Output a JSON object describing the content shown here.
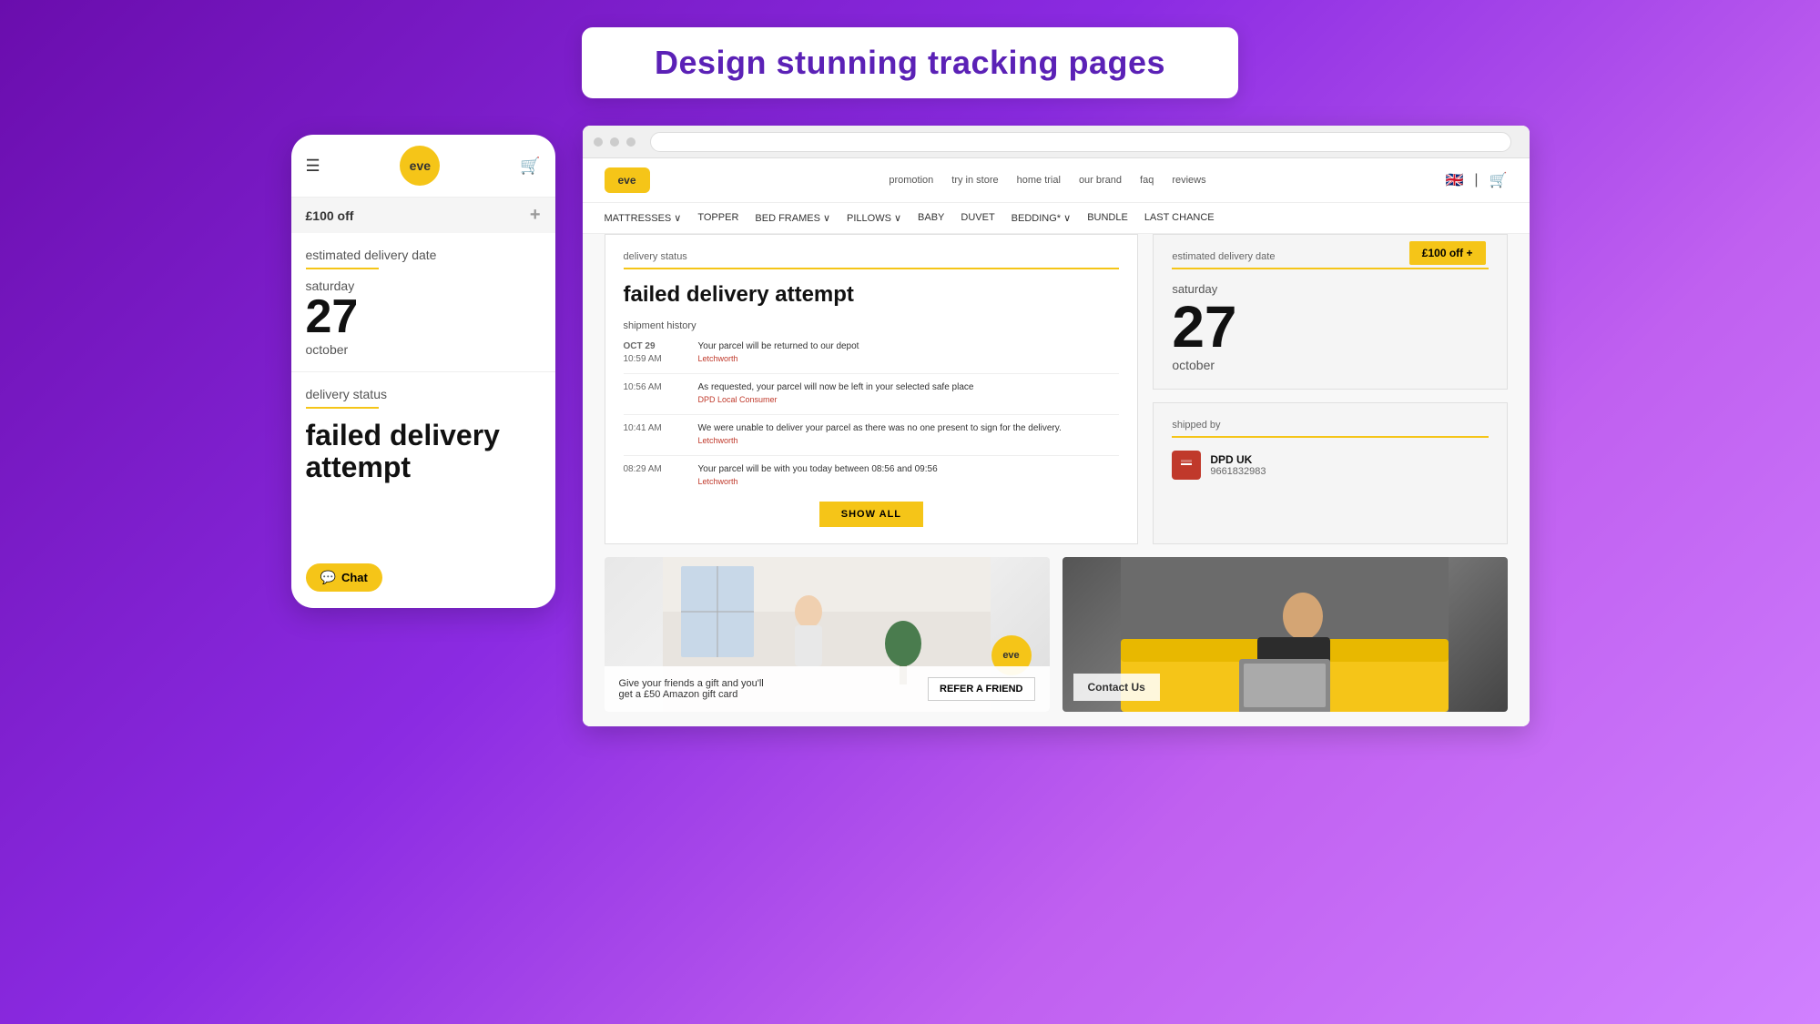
{
  "header": {
    "title": "Design stunning tracking pages"
  },
  "mobile": {
    "logo": "eve",
    "promo": "£100 off",
    "estimated_delivery": {
      "label": "estimated delivery date",
      "day_name": "saturday",
      "day_number": "27",
      "month": "october"
    },
    "delivery_status": {
      "label": "delivery status",
      "status": "failed delivery attempt"
    },
    "chat_button": "Chat"
  },
  "browser": {
    "store": {
      "logo": "eve",
      "nav_top": [
        "promotion",
        "try in store",
        "home trial",
        "our brand",
        "faq",
        "reviews"
      ],
      "nav_main": [
        "MATTRESSES ∨",
        "TOPPER",
        "BED FRAMES ∨",
        "PILLOWS ∨",
        "BABY",
        "DUVET",
        "BEDDING* ∨",
        "BUNDLE",
        "LAST CHANCE"
      ],
      "promo_badge": "£100 off  +"
    },
    "delivery_card": {
      "section_label": "delivery status",
      "status_title": "failed delivery attempt",
      "shipment_history_label": "shipment history",
      "history": [
        {
          "date": "OCT 29",
          "time": "10:59 AM",
          "text": "Your parcel will be returned to our depot",
          "sub": "Letchworth"
        },
        {
          "date": "",
          "time": "10:56 AM",
          "text": "As requested, your parcel will now be left in your selected safe place",
          "sub": "DPD Local Consumer"
        },
        {
          "date": "",
          "time": "10:41 AM",
          "text": "We were unable to deliver your parcel as there was no one present to sign for the delivery.",
          "sub": "Letchworth"
        },
        {
          "date": "",
          "time": "08:29 AM",
          "text": "Your parcel will be with you today between 08:56 and 09:56",
          "sub": "Letchworth"
        }
      ],
      "show_all_button": "SHOW ALL"
    },
    "estimated_card": {
      "section_label": "estimated delivery date",
      "day_name": "saturday",
      "day_number": "27",
      "month": "october"
    },
    "shipped_card": {
      "section_label": "shipped by",
      "carrier_name": "DPD UK",
      "tracking_number": "9661832983"
    },
    "bottom_left": {
      "refer_text": "Give your friends a gift and you'll get a £50 Amazon gift card",
      "refer_button": "REFER A FRIEND"
    },
    "bottom_right": {
      "contact_button": "Contact Us"
    }
  }
}
